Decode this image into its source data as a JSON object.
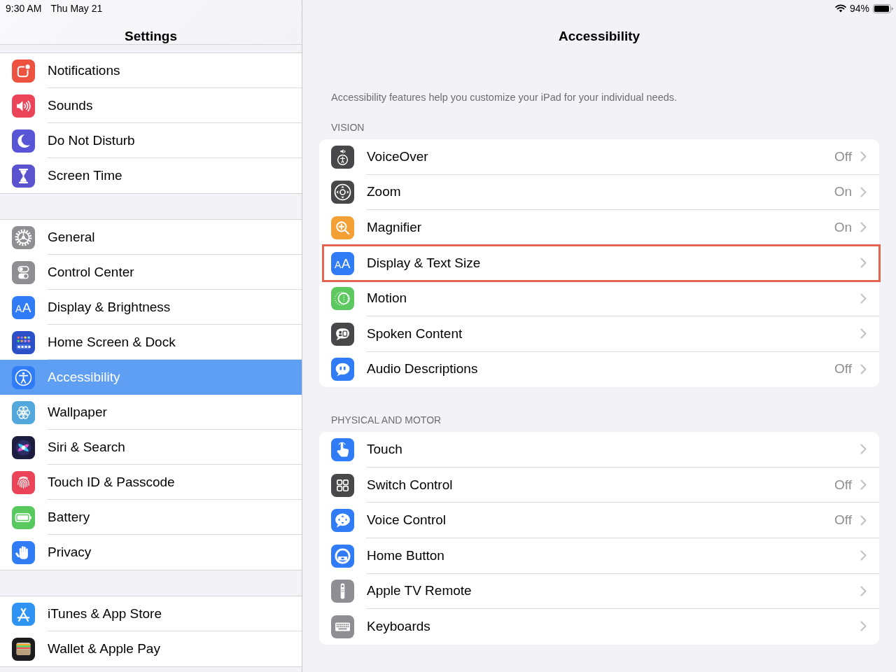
{
  "status_bar": {
    "time": "9:30 AM",
    "date": "Thu May 21",
    "battery": "94%"
  },
  "sidebar": {
    "title": "Settings",
    "groups": [
      {
        "items": [
          {
            "label": "Notifications",
            "color": "#ed5140",
            "selected": false
          },
          {
            "label": "Sounds",
            "color": "#eb4459",
            "selected": false
          },
          {
            "label": "Do Not Disturb",
            "color": "#5856d6",
            "selected": false
          },
          {
            "label": "Screen Time",
            "color": "#5a52cf",
            "selected": false
          }
        ]
      },
      {
        "items": [
          {
            "label": "General",
            "color": "#8e8e93",
            "selected": false
          },
          {
            "label": "Control Center",
            "color": "#8e8e93",
            "selected": false
          },
          {
            "label": "Display & Brightness",
            "color": "#2f7cf6",
            "icon_text": "AA",
            "selected": false
          },
          {
            "label": "Home Screen & Dock",
            "color": "#2b4fc7",
            "selected": false
          },
          {
            "label": "Accessibility",
            "color": "#2f7cf6",
            "selected": true
          },
          {
            "label": "Wallpaper",
            "color": "#52a7dc",
            "selected": false
          },
          {
            "label": "Siri & Search",
            "color": "#1d1d3f",
            "selected": false
          },
          {
            "label": "Touch ID & Passcode",
            "color": "#eb4459",
            "selected": false
          },
          {
            "label": "Battery",
            "color": "#58c95e",
            "selected": false
          },
          {
            "label": "Privacy",
            "color": "#2f7cf6",
            "selected": false
          }
        ]
      },
      {
        "items": [
          {
            "label": "iTunes & App Store",
            "color": "#2f93f3",
            "selected": false
          },
          {
            "label": "Wallet & Apple Pay",
            "color": "#1c1c1e",
            "selected": false
          }
        ]
      }
    ]
  },
  "main": {
    "title": "Accessibility",
    "description": "Accessibility features help you customize your iPad for your individual needs.",
    "sections": [
      {
        "header": "VISION",
        "items": [
          {
            "label": "VoiceOver",
            "value": "Off",
            "color": "#48484a",
            "highlighted": false
          },
          {
            "label": "Zoom",
            "value": "On",
            "color": "#48484a",
            "highlighted": false
          },
          {
            "label": "Magnifier",
            "value": "On",
            "color": "#f5a034",
            "highlighted": false
          },
          {
            "label": "Display & Text Size",
            "color": "#2f7cf6",
            "icon_text": "AA",
            "highlighted": true
          },
          {
            "label": "Motion",
            "color": "#5cc85f",
            "highlighted": false
          },
          {
            "label": "Spoken Content",
            "color": "#48484a",
            "highlighted": false
          },
          {
            "label": "Audio Descriptions",
            "value": "Off",
            "color": "#2f7cf6",
            "highlighted": false
          }
        ]
      },
      {
        "header": "PHYSICAL AND MOTOR",
        "items": [
          {
            "label": "Touch",
            "color": "#2f7cf6",
            "highlighted": false
          },
          {
            "label": "Switch Control",
            "value": "Off",
            "color": "#48484a",
            "highlighted": false
          },
          {
            "label": "Voice Control",
            "value": "Off",
            "color": "#2f7cf6",
            "highlighted": false
          },
          {
            "label": "Home Button",
            "color": "#2f7cf6",
            "highlighted": false
          },
          {
            "label": "Apple TV Remote",
            "color": "#8e8e93",
            "highlighted": false
          },
          {
            "label": "Keyboards",
            "color": "#8e8e93",
            "highlighted": false
          }
        ]
      }
    ]
  }
}
